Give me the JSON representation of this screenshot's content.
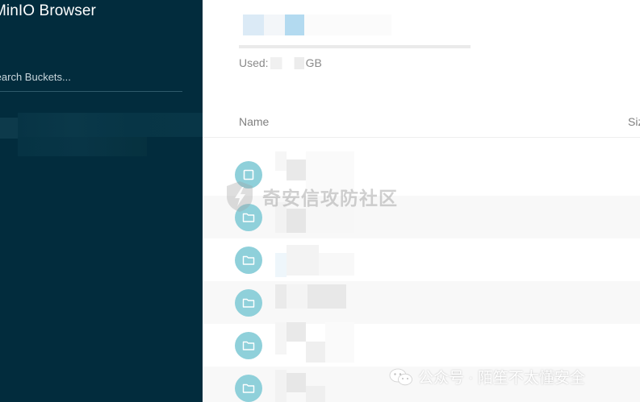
{
  "sidebar": {
    "title": "MinIO Browser",
    "search_placeholder": "Search Buckets..."
  },
  "main": {
    "used_label": "Used:",
    "used_unit": "GB",
    "columns": {
      "name": "Name",
      "size": "Size"
    },
    "rows": [
      {
        "icon": "bucket-icon"
      },
      {
        "icon": "folder-icon"
      },
      {
        "icon": "folder-icon"
      },
      {
        "icon": "folder-icon"
      },
      {
        "icon": "folder-icon"
      },
      {
        "icon": "folder-icon"
      }
    ]
  },
  "watermarks": {
    "center": "奇安信攻防社区",
    "bottom": "公众号 · 陌笙不太懂安全"
  },
  "colors": {
    "sidebar_bg": "#022c3d",
    "icon_bg": "#8fd0da",
    "accent_blue": "#b3daf0"
  }
}
